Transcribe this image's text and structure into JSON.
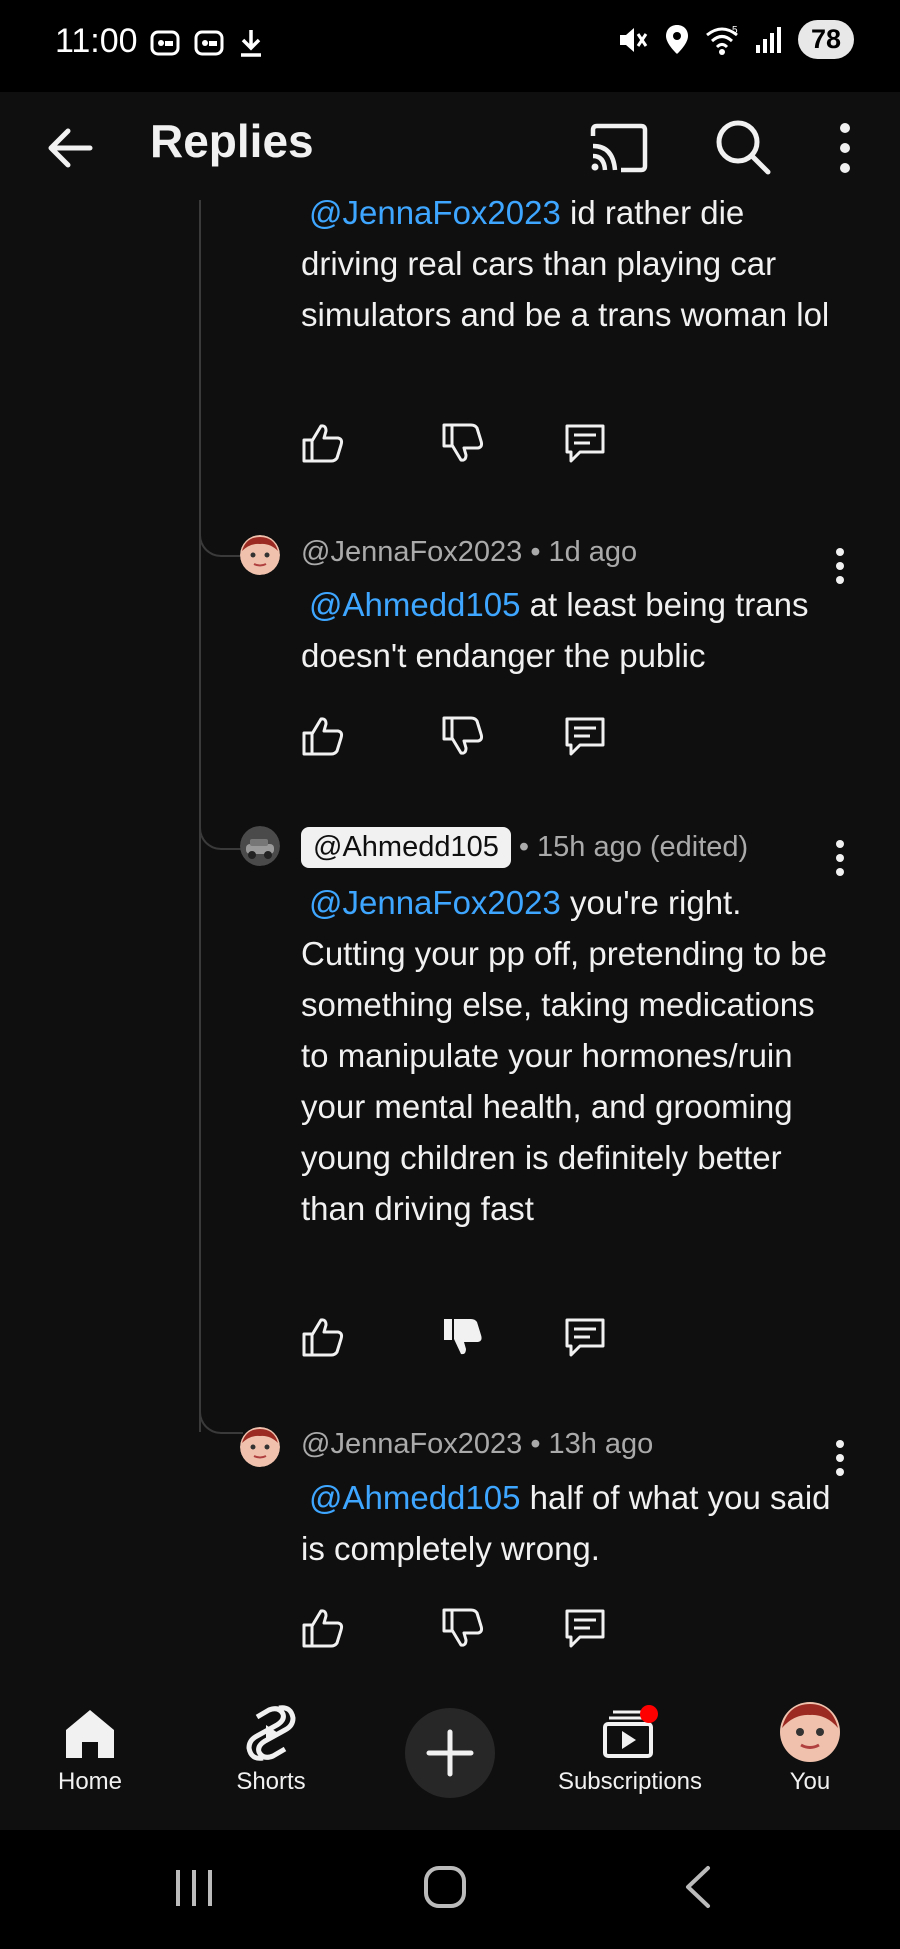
{
  "status_bar": {
    "time": "11:00",
    "battery": "78",
    "icons": [
      "screenshot-icon",
      "screenshot-icon",
      "download-icon",
      "mute-icon",
      "location-icon",
      "wifi-icon",
      "signal-icon"
    ]
  },
  "app_bar": {
    "title": "Replies",
    "icons": [
      "back-arrow-icon",
      "cast-icon",
      "search-icon",
      "more-vertical-icon"
    ]
  },
  "comments": [
    {
      "author": "",
      "timestamp": "",
      "mention": "@JennaFox2023",
      "text": " id rather die driving real cars than playing car simulators and be a trans woman lol"
    },
    {
      "author": "@JennaFox2023",
      "timestamp": "1d ago",
      "mention": "@Ahmedd105",
      "text": " at least being trans doesn't endanger the public"
    },
    {
      "author": "@Ahmedd105",
      "timestamp": "15h ago (edited)",
      "mention": "@JennaFox2023",
      "text": " you're right. Cutting your pp off, pretending to be something else, taking medications to manipulate your hormones/ruin your mental health, and grooming young children is definitely better than driving fast",
      "disliked": true
    },
    {
      "author": "@JennaFox2023",
      "timestamp": "13h ago",
      "mention": "@Ahmedd105",
      "text": " half of what you said is completely wrong."
    }
  ],
  "bottom_nav": {
    "home": "Home",
    "shorts": "Shorts",
    "subscriptions": "Subscriptions",
    "you": "You"
  },
  "colors": {
    "background": "#0f0f0f",
    "mention": "#3ea6ff",
    "notification_dot": "#ff0000"
  }
}
